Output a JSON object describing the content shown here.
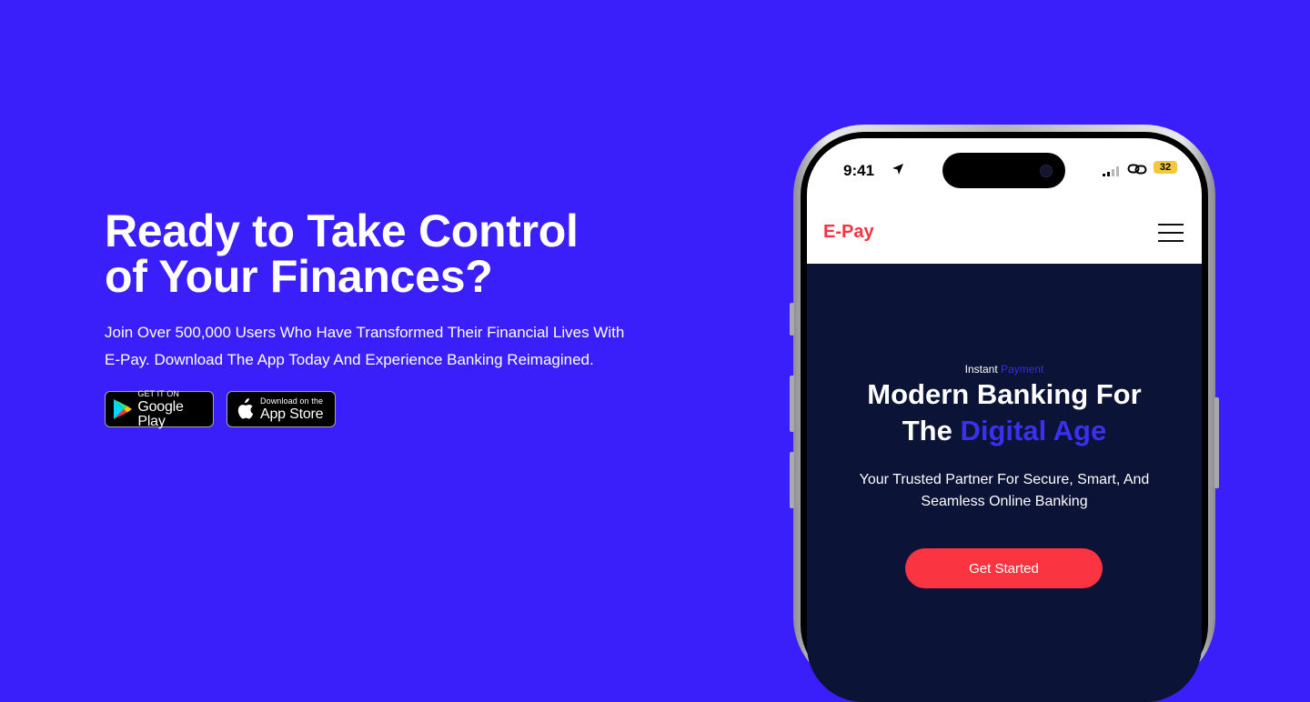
{
  "hero": {
    "headline_line1": "Ready to Take Control",
    "headline_line2": "of Your Finances?",
    "subtext_line1": "Join Over 500,000 Users Who Have Transformed Their Financial Lives With",
    "subtext_line2": "E-Pay. Download The App Today And Experience Banking Reimagined."
  },
  "stores": {
    "google": {
      "small": "GET IT ON",
      "big": "Google Play",
      "icon": "google-play-icon"
    },
    "apple": {
      "small": "Download on the",
      "big": "App Store",
      "icon": "apple-icon"
    }
  },
  "phone": {
    "status": {
      "time": "9:41",
      "battery": "32"
    },
    "app": {
      "brand": "E-Pay",
      "eyebrow_plain": "Instant",
      "eyebrow_highlight": "Payment",
      "title_line1": "Modern Banking For",
      "title_line2_plain": "The",
      "title_line2_highlight": "Digital Age",
      "sub_line1": "Your Trusted Partner For Secure, Smart, And",
      "sub_line2": "Seamless Online Banking",
      "cta": "Get Started"
    }
  },
  "colors": {
    "background": "#3a1ffb",
    "brand": "#f5333f",
    "cta": "#fa3440",
    "hero_bg": "#0b1337",
    "highlight": "#3b2ff0"
  }
}
